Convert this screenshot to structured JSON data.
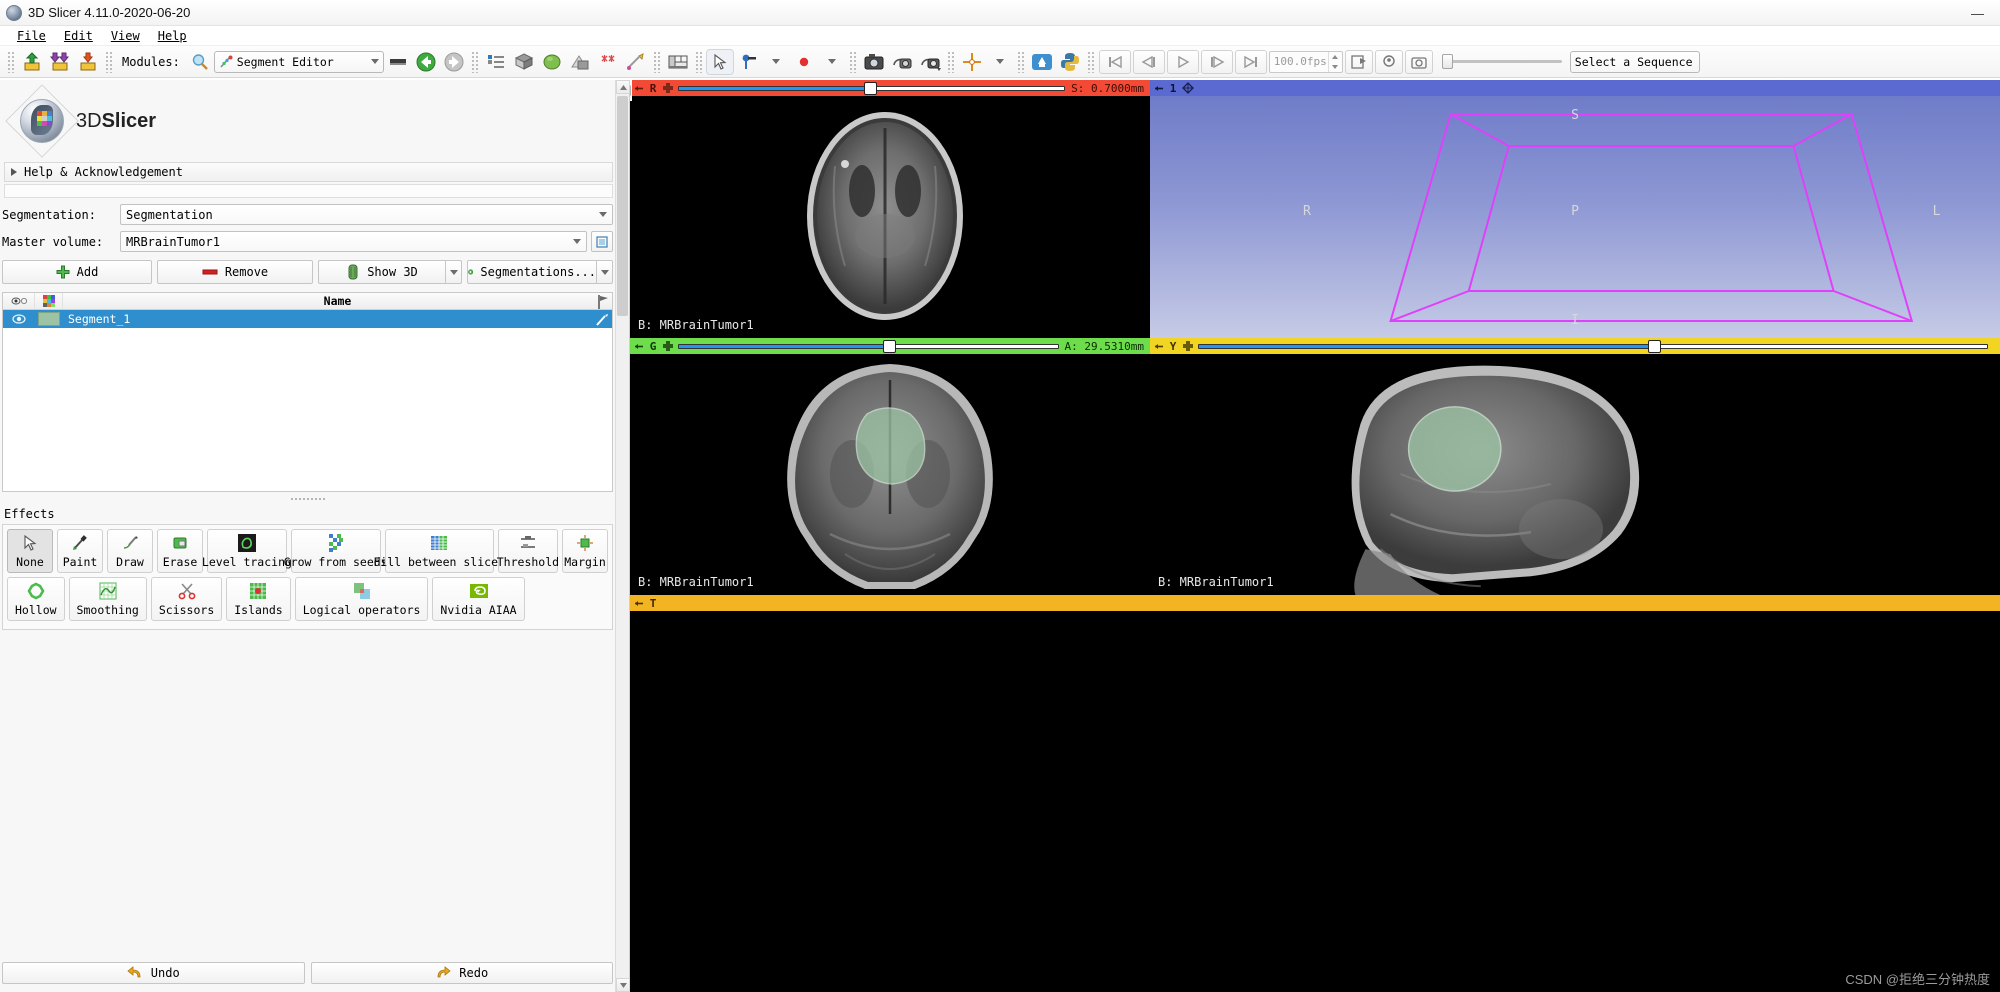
{
  "window": {
    "title": "3D Slicer 4.11.0-2020-06-20",
    "app_icon": "slicer-logo-icon",
    "minimize": "—",
    "maximize": "❑",
    "close": "✕"
  },
  "menubar": {
    "items": [
      {
        "label": "File",
        "mnemonic": "F"
      },
      {
        "label": "Edit",
        "mnemonic": "E"
      },
      {
        "label": "View",
        "mnemonic": "V"
      },
      {
        "label": "Help",
        "mnemonic": "H"
      }
    ]
  },
  "toolbar": {
    "load_data_icon": "load-data-icon",
    "load_dicom_icon": "load-dicom-icon",
    "save_data_icon": "save-data-icon",
    "modules_label": "Modules:",
    "search_icon": "search-module-icon",
    "module_selected": "Segment Editor",
    "module_icon": "segment-editor-icon",
    "history_icon": "module-history-icon",
    "previous_icon": "module-previous-icon",
    "next_icon": "module-next-icon",
    "extension_icon": "extension-manager-icon",
    "layout_icon": "layout-icon",
    "favorite_modules": [
      "volumes-icon",
      "models-icon",
      "scene-views-icon",
      "volume-rendering-icon",
      "markups-icon",
      "transforms-icon"
    ],
    "mouse_mode_icon": "mouse-mode-pointer-icon",
    "window_level_icon": "window-level-icon",
    "crosshair_icon": "crosshair-icon",
    "markup_place_icon": "place-markup-icon",
    "screenshot_icons": [
      "capture-screenshot-icon",
      "capture-viewport-icon",
      "capture-full-icon"
    ],
    "crosshair_toggle_icon": "crosshair-toggle-icon",
    "center_icon": "center-view-icon",
    "python_icon": "python-console-icon",
    "sequence_first_icon": "seq-first-icon",
    "sequence_prev_icon": "seq-prev-icon",
    "sequence_play_icon": "seq-play-icon",
    "sequence_next_icon": "seq-next-icon",
    "sequence_last_icon": "seq-last-icon",
    "fps_value": "100.0fps",
    "record_icon": "seq-record-icon",
    "seq_browser_icon": "seq-browser-icon",
    "seq_snapshot_icon": "seq-snapshot-icon",
    "seq_slider_value": 0,
    "sequence_select": "Select a Sequence"
  },
  "left_panel": {
    "logo_text_1": "3D",
    "logo_text_2": "Slicer",
    "help_section": "Help & Acknowledgement",
    "segmentation_label": "Segmentation:",
    "segmentation_value": "Segmentation",
    "master_volume_label": "Master volume:",
    "master_volume_value": "MRBrainTumor1",
    "buttons": {
      "add": "Add",
      "remove": "Remove",
      "show_3d": "Show 3D",
      "segmentations": "Segmentations..."
    },
    "segment_table": {
      "header_name": "Name",
      "rows": [
        {
          "name": "Segment_1",
          "color": "#9cc3a4",
          "visible": true,
          "selected": true
        }
      ]
    },
    "effects_label": "Effects",
    "effects_row1": [
      {
        "label": "None",
        "icon": "cursor-arrow-icon",
        "active": true
      },
      {
        "label": "Paint",
        "icon": "paint-brush-icon",
        "active": false
      },
      {
        "label": "Draw",
        "icon": "draw-pen-icon",
        "active": false
      },
      {
        "label": "Erase",
        "icon": "eraser-icon",
        "active": false
      },
      {
        "label": "Level tracing",
        "icon": "level-tracing-icon",
        "active": false
      },
      {
        "label": "Grow from seeds",
        "icon": "grow-from-seeds-icon",
        "active": false
      },
      {
        "label": "Fill between slices",
        "icon": "fill-between-slices-icon",
        "active": false
      },
      {
        "label": "Threshold",
        "icon": "threshold-icon",
        "active": false
      },
      {
        "label": "Margin",
        "icon": "margin-icon",
        "active": false
      }
    ],
    "effects_row2": [
      {
        "label": "Hollow",
        "icon": "hollow-icon",
        "active": false
      },
      {
        "label": "Smoothing",
        "icon": "smoothing-icon",
        "active": false
      },
      {
        "label": "Scissors",
        "icon": "scissors-icon",
        "active": false
      },
      {
        "label": "Islands",
        "icon": "islands-icon",
        "active": false
      },
      {
        "label": "Logical operators",
        "icon": "logical-operators-icon",
        "active": false
      },
      {
        "label": "Nvidia AIAA",
        "icon": "nvidia-aiaa-icon",
        "active": false
      }
    ],
    "undo": "Undo",
    "redo": "Redo"
  },
  "views": {
    "axial": {
      "color": "#f34a36",
      "letter": "R",
      "slice_value": "S:  0.7000mm",
      "slider_pos_pct": 49,
      "volume_label": "B: MRBrainTumor1",
      "pin_icon": "pin-icon",
      "reset_icon": "slice-reset-icon"
    },
    "coronal": {
      "color": "#6ddd4c",
      "letter": "G",
      "slice_value": "A: 29.5310mm",
      "slider_pos_pct": 55,
      "volume_label": "B: MRBrainTumor1",
      "pin_icon": "pin-icon",
      "reset_icon": "slice-reset-icon"
    },
    "sagittal": {
      "color": "#f2d422",
      "letter": "Y",
      "slice_value": "",
      "slider_pos_pct": 58,
      "volume_label": "B: MRBrainTumor1",
      "pin_icon": "pin-icon",
      "reset_icon": "slice-reset-icon"
    },
    "threed": {
      "color": "#5b6ad0",
      "label": "1",
      "pin_icon": "pin-icon",
      "view_icon": "3d-view-icon",
      "orientation": {
        "top": "S",
        "left": "R",
        "center": "P",
        "right": "L",
        "bottom": "I"
      },
      "box_color": "#e040fb"
    },
    "bottom_bar": {
      "color": "#f2b422",
      "letter": "T",
      "pin_icon": "pin-icon"
    }
  },
  "watermark": "CSDN @拒绝三分钟热度",
  "colors": {
    "axial_red": "#f34a36",
    "coronal_green": "#6ddd4c",
    "sagittal_yellow": "#f2d422",
    "threed_blue": "#5b6ad0",
    "selection_blue": "#2f8fce",
    "segment_green": "#9cc3a4",
    "box_magenta": "#e040fb"
  }
}
